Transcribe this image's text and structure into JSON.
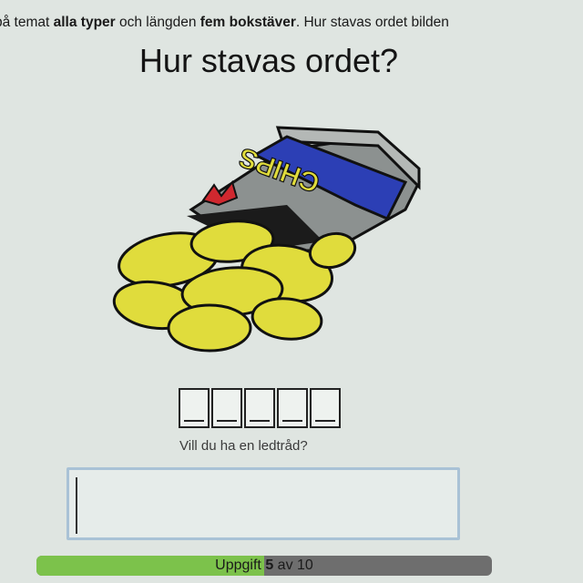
{
  "instructions": {
    "part1": "på temat ",
    "bold1": "alla typer",
    "part2": " och längden ",
    "bold2": "fem bokstäver",
    "part3": ". Hur stavas ordet bilden"
  },
  "question": "Hur stavas ordet?",
  "picture": {
    "bag_label": "CHIPS",
    "colors": {
      "chips": "#e0dc3c",
      "bag": "#8c9190",
      "band": "#2c3fb5",
      "tear": "#d0282f"
    }
  },
  "word": {
    "length": 5
  },
  "hint_link": "Vill du ha en ledtråd?",
  "answer": {
    "value": ""
  },
  "progress": {
    "label_prefix": "Uppgift ",
    "current": "5",
    "label_suffix": " av 10",
    "fraction": 0.5
  }
}
